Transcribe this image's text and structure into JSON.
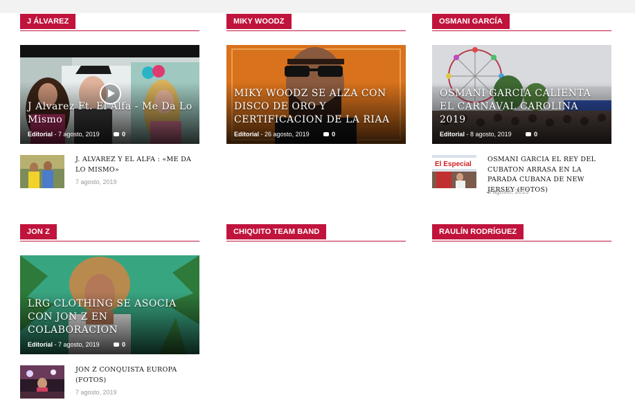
{
  "sections": [
    {
      "category": "J ÁLVAREZ",
      "feature": {
        "title": "J Alvarez Ft. El Alfa - Me Da Lo Mismo",
        "author": "Editorial",
        "date": "7 agosto, 2019",
        "comments": "0",
        "has_play": true
      },
      "small": {
        "title": "J. ALVAREZ Y EL ALFA : «ME DA LO MISMO»",
        "date": "7 agosto, 2019"
      }
    },
    {
      "category": "MIKY WOODZ",
      "feature": {
        "title": "MIKY WOODZ SE ALZA CON DISCO DE ORO Y CERTIFICACION DE LA RIAA",
        "author": "Editorial",
        "date": "26 agosto, 2019",
        "comments": "0"
      }
    },
    {
      "category": "OSMANI GARCÍA",
      "feature": {
        "title": "OSMANI GARCIA CALIENTA EL CARNAVAL CAROLINA 2019",
        "author": "Editorial",
        "date": "8 agosto, 2019",
        "comments": "0"
      },
      "small": {
        "title": "OSMANI GARCIA EL REY DEL CUBATON ARRASA EN LA PARADA CUBANA DE NEW JERSEY (FOTOS)",
        "date": "8 agosto, 2019",
        "thumb_text": "El Especial"
      }
    },
    {
      "category": "JON Z",
      "feature": {
        "title": "LRG CLOTHING SE ASOCIA CON JON Z EN COLABORACION",
        "author": "Editorial",
        "date": "7 agosto, 2019",
        "comments": "0"
      },
      "small": {
        "title": "JON Z CONQUISTA EUROPA (FOTOS)",
        "date": "7 agosto, 2019"
      }
    },
    {
      "category": "CHIQUITO TEAM BAND"
    },
    {
      "category": "RAULÍN RODRÍGUEZ"
    }
  ],
  "colors": {
    "accent": "#c0143c",
    "topbar": "#f2f2f2"
  },
  "icons": {
    "play": "play-icon",
    "comment": "comment-icon"
  }
}
